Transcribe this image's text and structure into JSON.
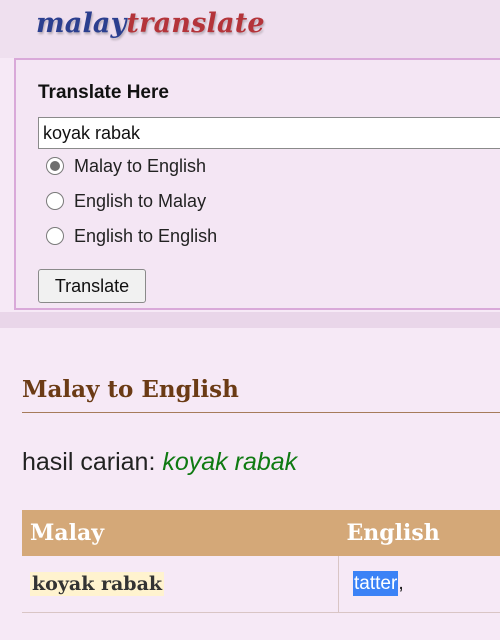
{
  "header": {
    "logo_part1": "malay",
    "logo_part2": "translate"
  },
  "translate_panel": {
    "title": "Translate Here",
    "search_value": "koyak rabak",
    "options": [
      {
        "label": "Malay to English",
        "checked": true
      },
      {
        "label": "English to Malay",
        "checked": false
      },
      {
        "label": "English to English",
        "checked": false
      }
    ],
    "button_label": "Translate"
  },
  "results": {
    "section_title": "Malay to English",
    "result_prefix": "hasil carian:",
    "result_term": "koyak rabak",
    "table": {
      "headers": [
        "Malay",
        "English"
      ],
      "rows": [
        {
          "malay": "koyak rabak",
          "english": "tatter",
          "suffix": ","
        }
      ]
    }
  },
  "colors": {
    "logo_blue": "#2b3f8f",
    "logo_red": "#b4343a",
    "header_bg": "#d4a878",
    "section_title": "#6b3b15",
    "search_term": "#0f7a12",
    "selection": "#3b82f6"
  }
}
